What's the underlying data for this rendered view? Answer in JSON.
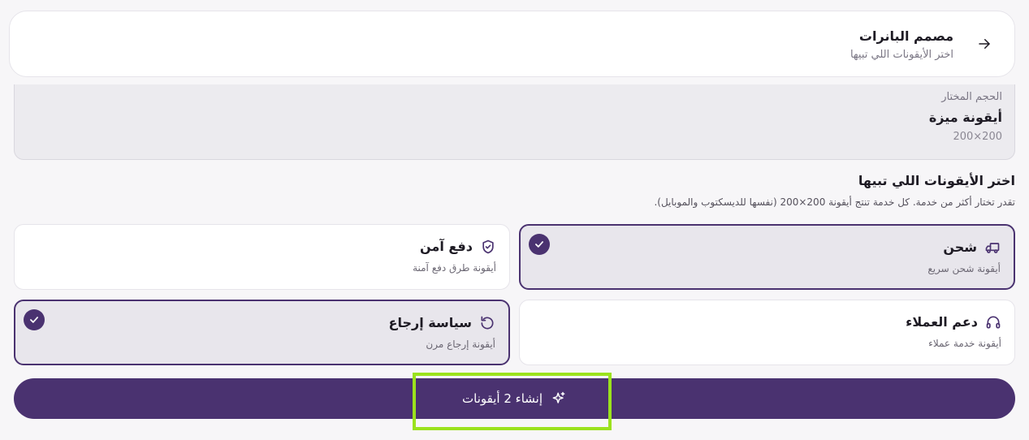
{
  "header": {
    "title": "مصمم البانرات",
    "subtitle": "اختر الأيقونات اللي تبيها",
    "back_icon": "arrow-right-icon"
  },
  "size_panel": {
    "label": "الحجم المختار",
    "name": "أيقونة ميزة",
    "dimensions": "200×200"
  },
  "section": {
    "title": "اختر الأيقونات اللي تبيها",
    "description": "تقدر تختار أكثر من خدمة. كل خدمة تنتج أيقونة 200×200 (نفسها للديسكتوب والموبايل)."
  },
  "services": [
    {
      "id": "shipping",
      "title": "شحن",
      "subtitle": "أيقونة شحن سريع",
      "icon": "truck-icon",
      "selected": true
    },
    {
      "id": "secure-payment",
      "title": "دفع آمن",
      "subtitle": "أيقونة طرق دفع آمنة",
      "icon": "shield-check-icon",
      "selected": false
    },
    {
      "id": "customer-support",
      "title": "دعم العملاء",
      "subtitle": "أيقونة خدمة عملاء",
      "icon": "headphones-icon",
      "selected": false
    },
    {
      "id": "return-policy",
      "title": "سياسة إرجاع",
      "subtitle": "أيقونة إرجاع مرن",
      "icon": "rotate-ccw-icon",
      "selected": true
    }
  ],
  "cta": {
    "label": "إنشاء 2 أيقونات",
    "icon": "sparkles-icon"
  },
  "colors": {
    "accent": "#4a3270",
    "highlight": "#9be21d",
    "selected_bg": "#e8e6ec"
  }
}
